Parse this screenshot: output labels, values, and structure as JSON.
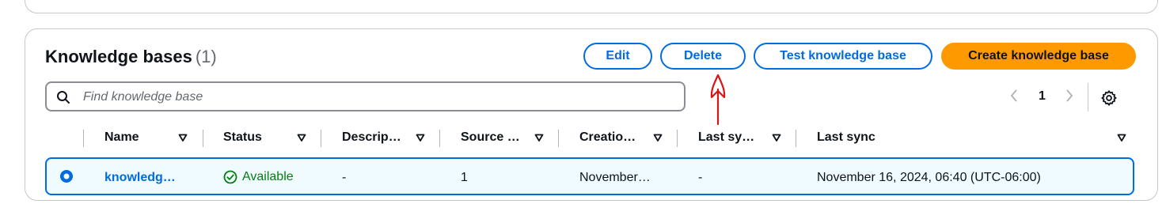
{
  "header": {
    "title": "Knowledge bases",
    "count": "(1)"
  },
  "buttons": {
    "edit": "Edit",
    "delete": "Delete",
    "test": "Test knowledge base",
    "create": "Create knowledge base"
  },
  "search": {
    "placeholder": "Find knowledge base"
  },
  "pagination": {
    "current_page": "1"
  },
  "table": {
    "columns": [
      "Name",
      "Status",
      "Descrip…",
      "Source …",
      "Creatio…",
      "Last sy…",
      "Last sync"
    ],
    "rows": [
      {
        "name": "knowledg…",
        "status": "Available",
        "description": "-",
        "source": "1",
        "creation": "November…",
        "last_sync_short": "-",
        "last_sync": "November 16, 2024, 06:40 (UTC-06:00)",
        "selected": true
      }
    ]
  },
  "colors": {
    "accent": "#006ce0",
    "primary_button": "#ff9900",
    "success": "#037f0c",
    "annotation": "#d91515"
  },
  "icons": [
    "search-icon",
    "chevron-left-icon",
    "chevron-right-icon",
    "settings-gear-icon",
    "sort-caret-icon",
    "check-circle-icon",
    "radio-selected-icon",
    "annotation-arrow-icon"
  ]
}
